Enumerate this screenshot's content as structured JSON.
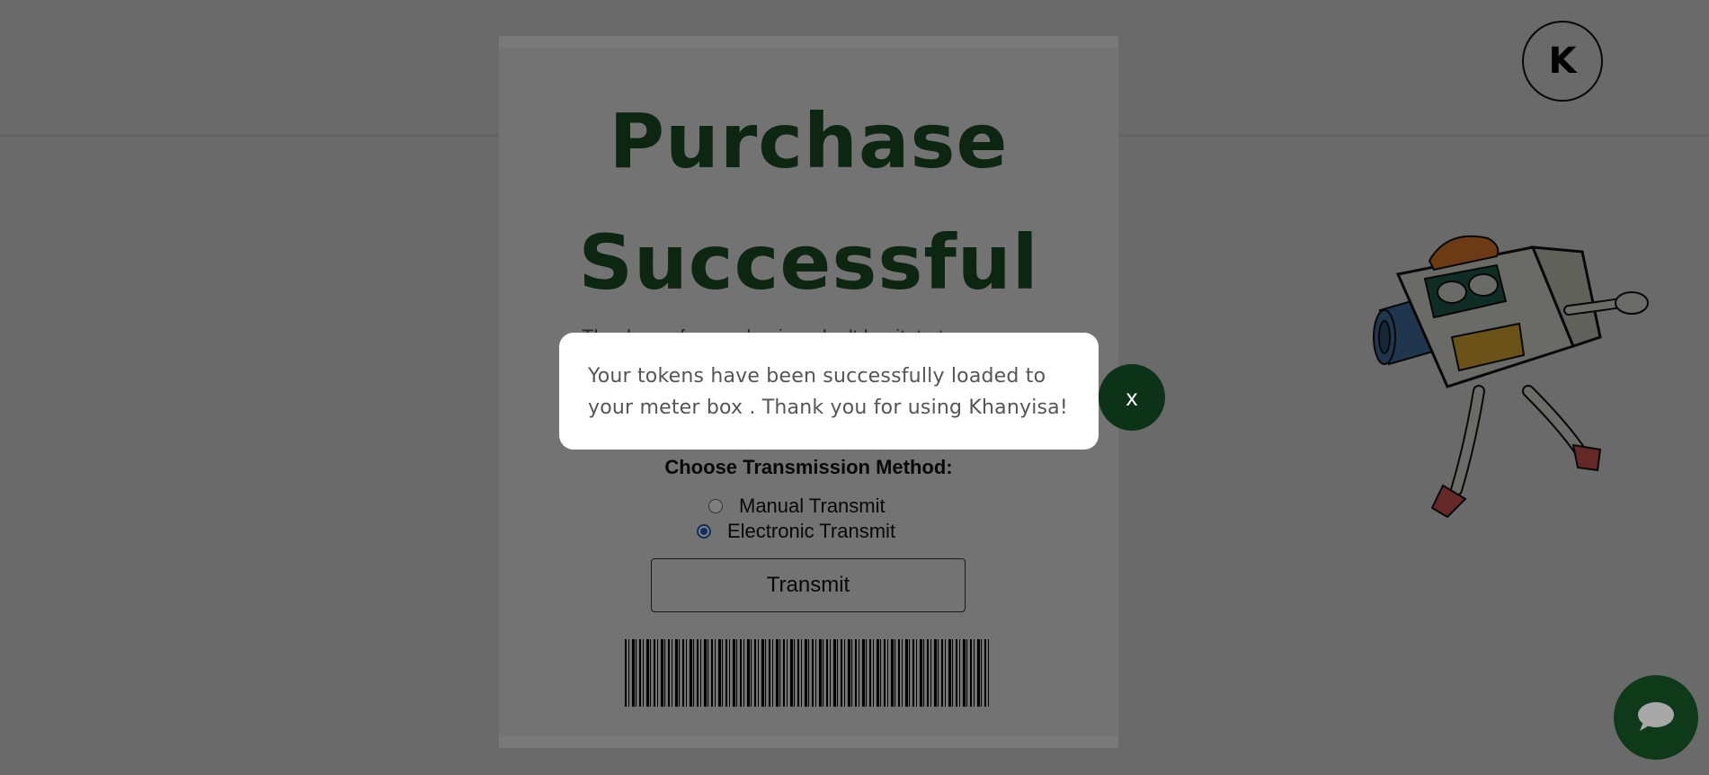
{
  "header": {
    "logo_letter": "K"
  },
  "receipt": {
    "title_line1": "Purchase",
    "title_line2": "Successful",
    "subtext": "Thank you for purchasing, don't hesitate to",
    "method_label": "Choose Transmission Method:",
    "options": [
      {
        "label": "Manual Transmit",
        "checked": false
      },
      {
        "label": "Electronic Transmit",
        "checked": true
      }
    ],
    "transmit_label": "Transmit"
  },
  "modal": {
    "message": "Your tokens have been successfully loaded to your meter box . Thank you for using Khanyisa!",
    "close_label": "x"
  },
  "colors": {
    "accent_green": "#0c3317",
    "title_green": "#1b4d24",
    "radio_blue": "#1f5fbf"
  },
  "icons": {
    "chat": "chat-bubble-icon",
    "mascot": "meter-mascot"
  }
}
